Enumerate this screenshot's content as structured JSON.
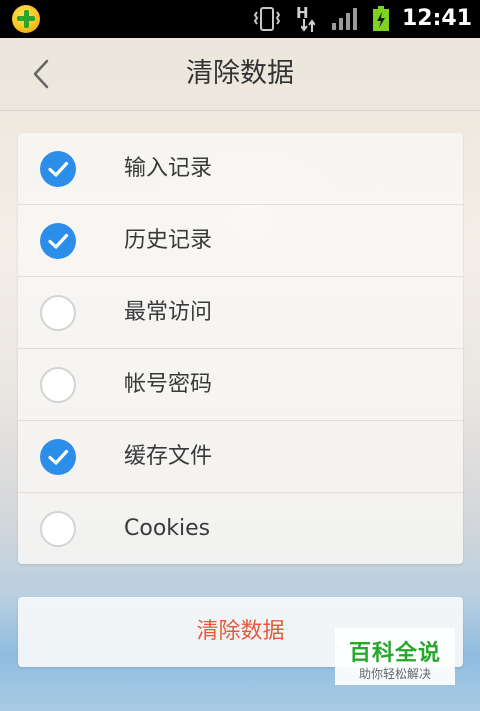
{
  "status_bar": {
    "time": "12:41",
    "data_indicator": "H",
    "icons": [
      "app-notification-icon",
      "vibrate-icon",
      "data-arrows-icon",
      "signal-icon",
      "battery-charging-icon"
    ]
  },
  "header": {
    "title": "清除数据",
    "back_icon": "chevron-left-icon"
  },
  "options": [
    {
      "label": "输入记录",
      "checked": true
    },
    {
      "label": "历史记录",
      "checked": true
    },
    {
      "label": "最常访问",
      "checked": false
    },
    {
      "label": "帐号密码",
      "checked": false
    },
    {
      "label": "缓存文件",
      "checked": true
    },
    {
      "label": "Cookies",
      "checked": false
    }
  ],
  "action": {
    "clear_label": "清除数据"
  },
  "watermark": {
    "title": "百科全说",
    "subtitle": "助你轻松解决"
  },
  "colors": {
    "checked": "#2c8ee9",
    "action_text": "#e65a3b",
    "watermark_green": "#27a72c"
  }
}
